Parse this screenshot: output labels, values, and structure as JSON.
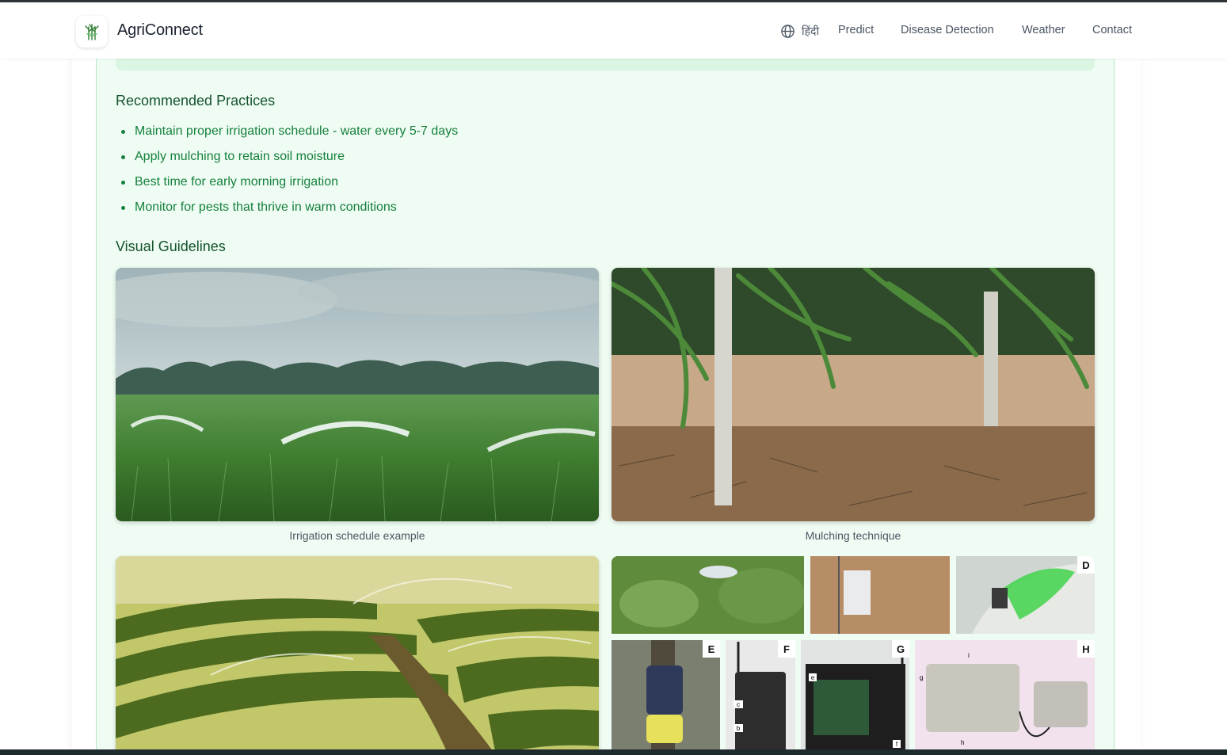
{
  "header": {
    "brand": "AgriConnect",
    "language_label": "हिंदी",
    "nav": [
      "Predict",
      "Disease Detection",
      "Weather",
      "Contact"
    ]
  },
  "practices": {
    "title": "Recommended Practices",
    "items": [
      "Maintain proper irrigation schedule - water every 5-7 days",
      "Apply mulching to retain soil moisture",
      "Best time for early morning irrigation",
      "Monitor for pests that thrive in warm conditions"
    ]
  },
  "guidelines": {
    "title": "Visual Guidelines",
    "images": [
      {
        "caption": "Irrigation schedule example"
      },
      {
        "caption": "Mulching technique"
      }
    ],
    "collage_letters": [
      "D",
      "E",
      "F",
      "G",
      "H"
    ],
    "collage_sub_labels": [
      "c",
      "b",
      "e",
      "f",
      "g",
      "h",
      "i"
    ]
  },
  "colors": {
    "card_bg": "#effcf3",
    "heading": "#14532d",
    "list_text": "#15803d",
    "caption": "#4b5563"
  }
}
